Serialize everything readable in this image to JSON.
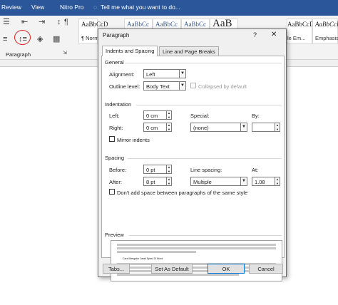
{
  "word": {
    "ribbon_tabs": [
      "Review",
      "View",
      "Nitro Pro"
    ],
    "tell_me": "Tell me what you want to do...",
    "group_label": "Paragraph",
    "styles": [
      {
        "sample": "AaBbCcD",
        "name": "¶ Norm"
      },
      {
        "sample": "AaBbCc",
        "name": ""
      },
      {
        "sample": "AaBbCc",
        "name": ""
      },
      {
        "sample": "AaBbCc",
        "name": ""
      },
      {
        "sample": "AaB",
        "name": ""
      },
      {
        "sample": "AaBbCcDc",
        "name": "le Em..."
      },
      {
        "sample": "AaBbCcDc",
        "name": "Emphasis"
      }
    ]
  },
  "dialog": {
    "title": "Paragraph",
    "help": "?",
    "close": "✕",
    "tabs": [
      "Indents and Spacing",
      "Line and Page Breaks"
    ],
    "general": {
      "title": "General",
      "alignment_label": "Alignment:",
      "alignment_value": "Left",
      "outline_label": "Outline level:",
      "outline_value": "Body Text",
      "collapsed_label": "Collapsed by default"
    },
    "indentation": {
      "title": "Indentation",
      "left_label": "Left:",
      "left_value": "0 cm",
      "right_label": "Right:",
      "right_value": "0 cm",
      "special_label": "Special:",
      "special_value": "(none)",
      "by_label": "By:",
      "by_value": "",
      "mirror_label": "Mirror indents"
    },
    "spacing": {
      "title": "Spacing",
      "before_label": "Before:",
      "before_value": "0 pt",
      "after_label": "After:",
      "after_value": "8 pt",
      "line_spacing_label": "Line spacing:",
      "line_spacing_value": "Multiple",
      "at_label": "At:",
      "at_value": "1.08",
      "dont_add_label": "Don't add space between paragraphs of the same style"
    },
    "preview": {
      "title": "Preview",
      "text": "Cara Mengatur Jarak Spasi Di Word"
    },
    "buttons": {
      "tabs": "Tabs...",
      "set_default": "Set As Default",
      "ok": "OK",
      "cancel": "Cancel"
    }
  }
}
